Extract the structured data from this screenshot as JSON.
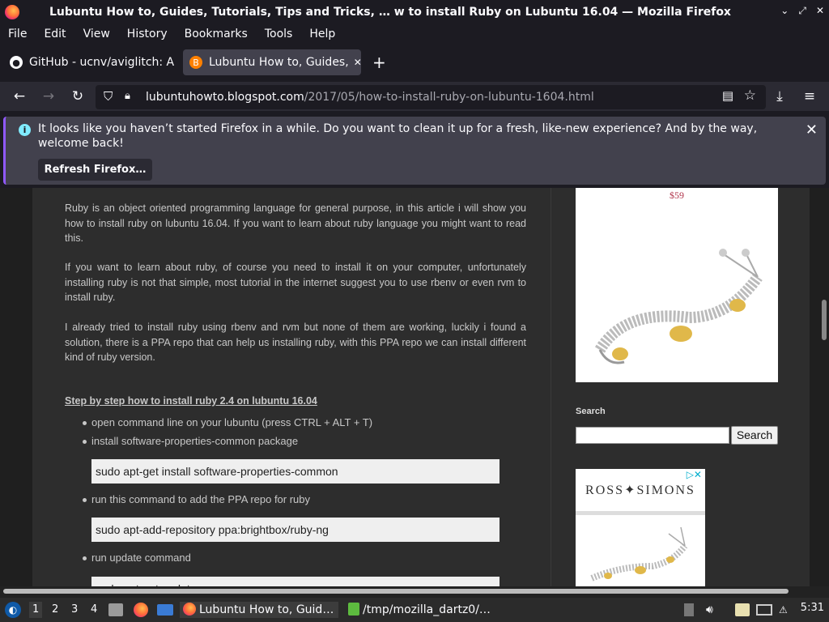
{
  "window": {
    "title": "Lubuntu How to, Guides, Tutorials, Tips and Tricks, …  w to install Ruby on Lubuntu 16.04 — Mozilla Firefox",
    "controls": [
      "⌄",
      "⤢",
      "✕"
    ]
  },
  "menu": [
    "File",
    "Edit",
    "View",
    "History",
    "Bookmarks",
    "Tools",
    "Help"
  ],
  "tabs": [
    {
      "label": "GitHub - ucnv/aviglitch: A",
      "icon": "github-icon",
      "active": false
    },
    {
      "label": "Lubuntu How to, Guides,",
      "icon": "blogger-icon",
      "active": true
    }
  ],
  "toolbar": {
    "url_host": "lubuntuhowto.blogspot.com",
    "url_path": "/2017/05/how-to-install-ruby-on-lubuntu-1604.html"
  },
  "notification": {
    "message": "It looks like you haven’t started Firefox in a while. Do you want to clean it up for a fresh, like-new experience? And by the way, welcome back!",
    "button": "Refresh Firefox…"
  },
  "article": {
    "p1": "Ruby is an object oriented programming language for general purpose, in this article i will show you how to install ruby on lubuntu 16.04. If you want to learn about ruby language you might want to read this.",
    "p2": "If you want to learn about ruby, of course you need to install it on your computer, unfortunately installing ruby is not that simple, most tutorial in the internet suggest you to use rbenv or even rvm to install ruby.",
    "p3": "I already tried to install ruby using rbenv and rvm but none of them are working, luckily i found a solution, there is a PPA repo that can help us installing ruby, with this PPA repo we can install different kind of ruby version.",
    "heading": "Step by step how to install ruby 2.4 on lubuntu 16.04",
    "steps": [
      "open command line on your lubuntu (press CTRL + ALT + T)",
      "install software-properties-common package",
      "run this command to add the PPA repo for ruby",
      "run update command"
    ],
    "code": [
      "sudo apt-get install software-properties-common",
      "sudo apt-add-repository ppa:brightbox/ruby-ng",
      "sudo apt-get update"
    ]
  },
  "sidebar": {
    "ad_price": "$59",
    "search_heading": "Search",
    "search_button": "Search",
    "ad2_brand": "ROSS✦SIMONS"
  },
  "taskbar": {
    "workspaces": [
      "1",
      "2",
      "3",
      "4"
    ],
    "window1": "Lubuntu How to, Guid…",
    "window2": "/tmp/mozilla_dartz0/…",
    "clock": "5:31"
  }
}
